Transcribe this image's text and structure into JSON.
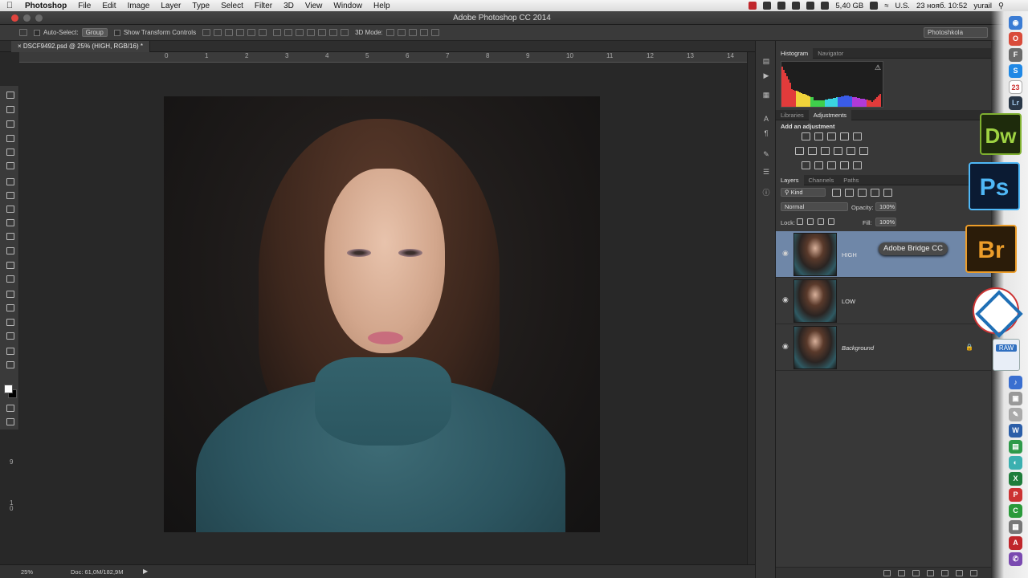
{
  "menubar": {
    "app_name": "Photoshop",
    "items": [
      "File",
      "Edit",
      "Image",
      "Layer",
      "Type",
      "Select",
      "Filter",
      "3D",
      "View",
      "Window",
      "Help"
    ],
    "storage": "5,40 GB",
    "input_lang": "U.S.",
    "datetime": "23 нояб. 10:52",
    "user": "yurail"
  },
  "window": {
    "title": "Adobe Photoshop CC 2014"
  },
  "options_bar": {
    "auto_select_label": "Auto-Select:",
    "auto_select_value": "Group",
    "show_transform_label": "Show Transform Controls",
    "mode_3d_label": "3D Mode:",
    "workspace": "Photoshkola"
  },
  "document": {
    "tab_title": "DSCF9492.psd @ 25% (HIGH, RGB/16) *"
  },
  "rulers": {
    "top": [
      "0",
      "1",
      "2",
      "3",
      "4",
      "5",
      "6",
      "7",
      "8",
      "9",
      "10",
      "11",
      "12",
      "13",
      "14"
    ],
    "left": [
      "9",
      "1\n0"
    ]
  },
  "status_bar": {
    "zoom": "25%",
    "doc_info": "Doc: 61,0M/182,9M",
    "arrow": "▶"
  },
  "panels": {
    "top_tabs": [
      "Histogram",
      "Navigator"
    ],
    "mid_tabs": [
      "Libraries",
      "Adjustments"
    ],
    "adjustments_title": "Add an adjustment",
    "layer_tabs": [
      "Layers",
      "Channels",
      "Paths"
    ],
    "filter_kind": "Kind",
    "blend_mode": "Normal",
    "opacity_label": "Opacity:",
    "opacity_value": "100%",
    "lock_label": "Lock:",
    "fill_label": "Fill:",
    "fill_value": "100%",
    "histogram_warning": "⚠"
  },
  "layers": [
    {
      "name": "HIGH",
      "selected": true,
      "visible": true,
      "locked": false
    },
    {
      "name": "LOW",
      "selected": false,
      "visible": true,
      "locked": false
    },
    {
      "name": "Background",
      "selected": false,
      "visible": true,
      "locked": true
    }
  ],
  "tooltip": {
    "text": "Adobe Bridge CC"
  },
  "dock": {
    "dw_label": "Dw",
    "ps_label": "Ps",
    "br_label": "Br",
    "raw_label": "RAW",
    "lr_label": "Lr",
    "calendar_day": "23",
    "s_label": "S"
  },
  "colors": {
    "selected_layer": "#6f87a8",
    "ps_accent": "#4fb8f7",
    "br_accent": "#ec9d2a",
    "dw_accent": "#9fd342"
  }
}
